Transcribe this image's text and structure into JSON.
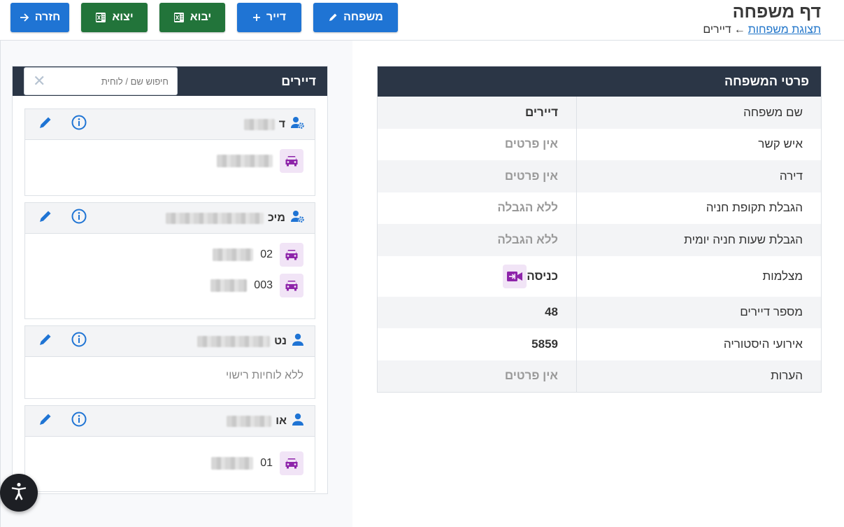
{
  "header": {
    "title": "דף משפחה",
    "breadcrumb_link": "תצוגת משפחות",
    "breadcrumb_arrow": "←",
    "breadcrumb_current": "דיירים"
  },
  "toolbar": {
    "family_label": "משפחה",
    "resident_label": "דייר",
    "import_label": "יבוא",
    "export_label": "יצוא",
    "back_label": "חזרה"
  },
  "residents": {
    "title": "דיירים",
    "search_placeholder": "חיפוש שם / לוחית",
    "cards": [
      {
        "name_prefix": "ד",
        "icon": "user-gear-icon",
        "plates": [
          "5061306"
        ]
      },
      {
        "name_prefix": "מיכ",
        "icon": "user-gear-icon",
        "plates": [
          "02",
          "003"
        ]
      },
      {
        "name_prefix": "נט",
        "icon": "user-icon",
        "plates": [],
        "empty_text": "ללא לוחיות רישוי"
      },
      {
        "name_prefix": "או",
        "icon": "user-icon",
        "plates": [
          "01"
        ]
      }
    ]
  },
  "details": {
    "title": "פרטי המשפחה",
    "rows": [
      {
        "label": "שם משפחה",
        "value": "דיירים"
      },
      {
        "label": "איש קשר",
        "value": "אין פרטים"
      },
      {
        "label": "דירה",
        "value": "אין פרטים"
      },
      {
        "label": "הגבלת תקופת חניה",
        "value": "ללא הגבלה"
      },
      {
        "label": "הגבלת שעות חניה יומית",
        "value": "ללא הגבלה"
      },
      {
        "label": "מצלמות",
        "value": "כניסה"
      },
      {
        "label": "מספר דיירים",
        "value": "48"
      },
      {
        "label": "אירועי היסטוריה",
        "value": "5859"
      },
      {
        "label": "הערות",
        "value": "אין פרטים"
      }
    ]
  },
  "colors": {
    "primary": "#1f74d4",
    "excel_green": "#22743a",
    "header_dark": "#2b3646",
    "car_purple": "#8e24aa"
  }
}
